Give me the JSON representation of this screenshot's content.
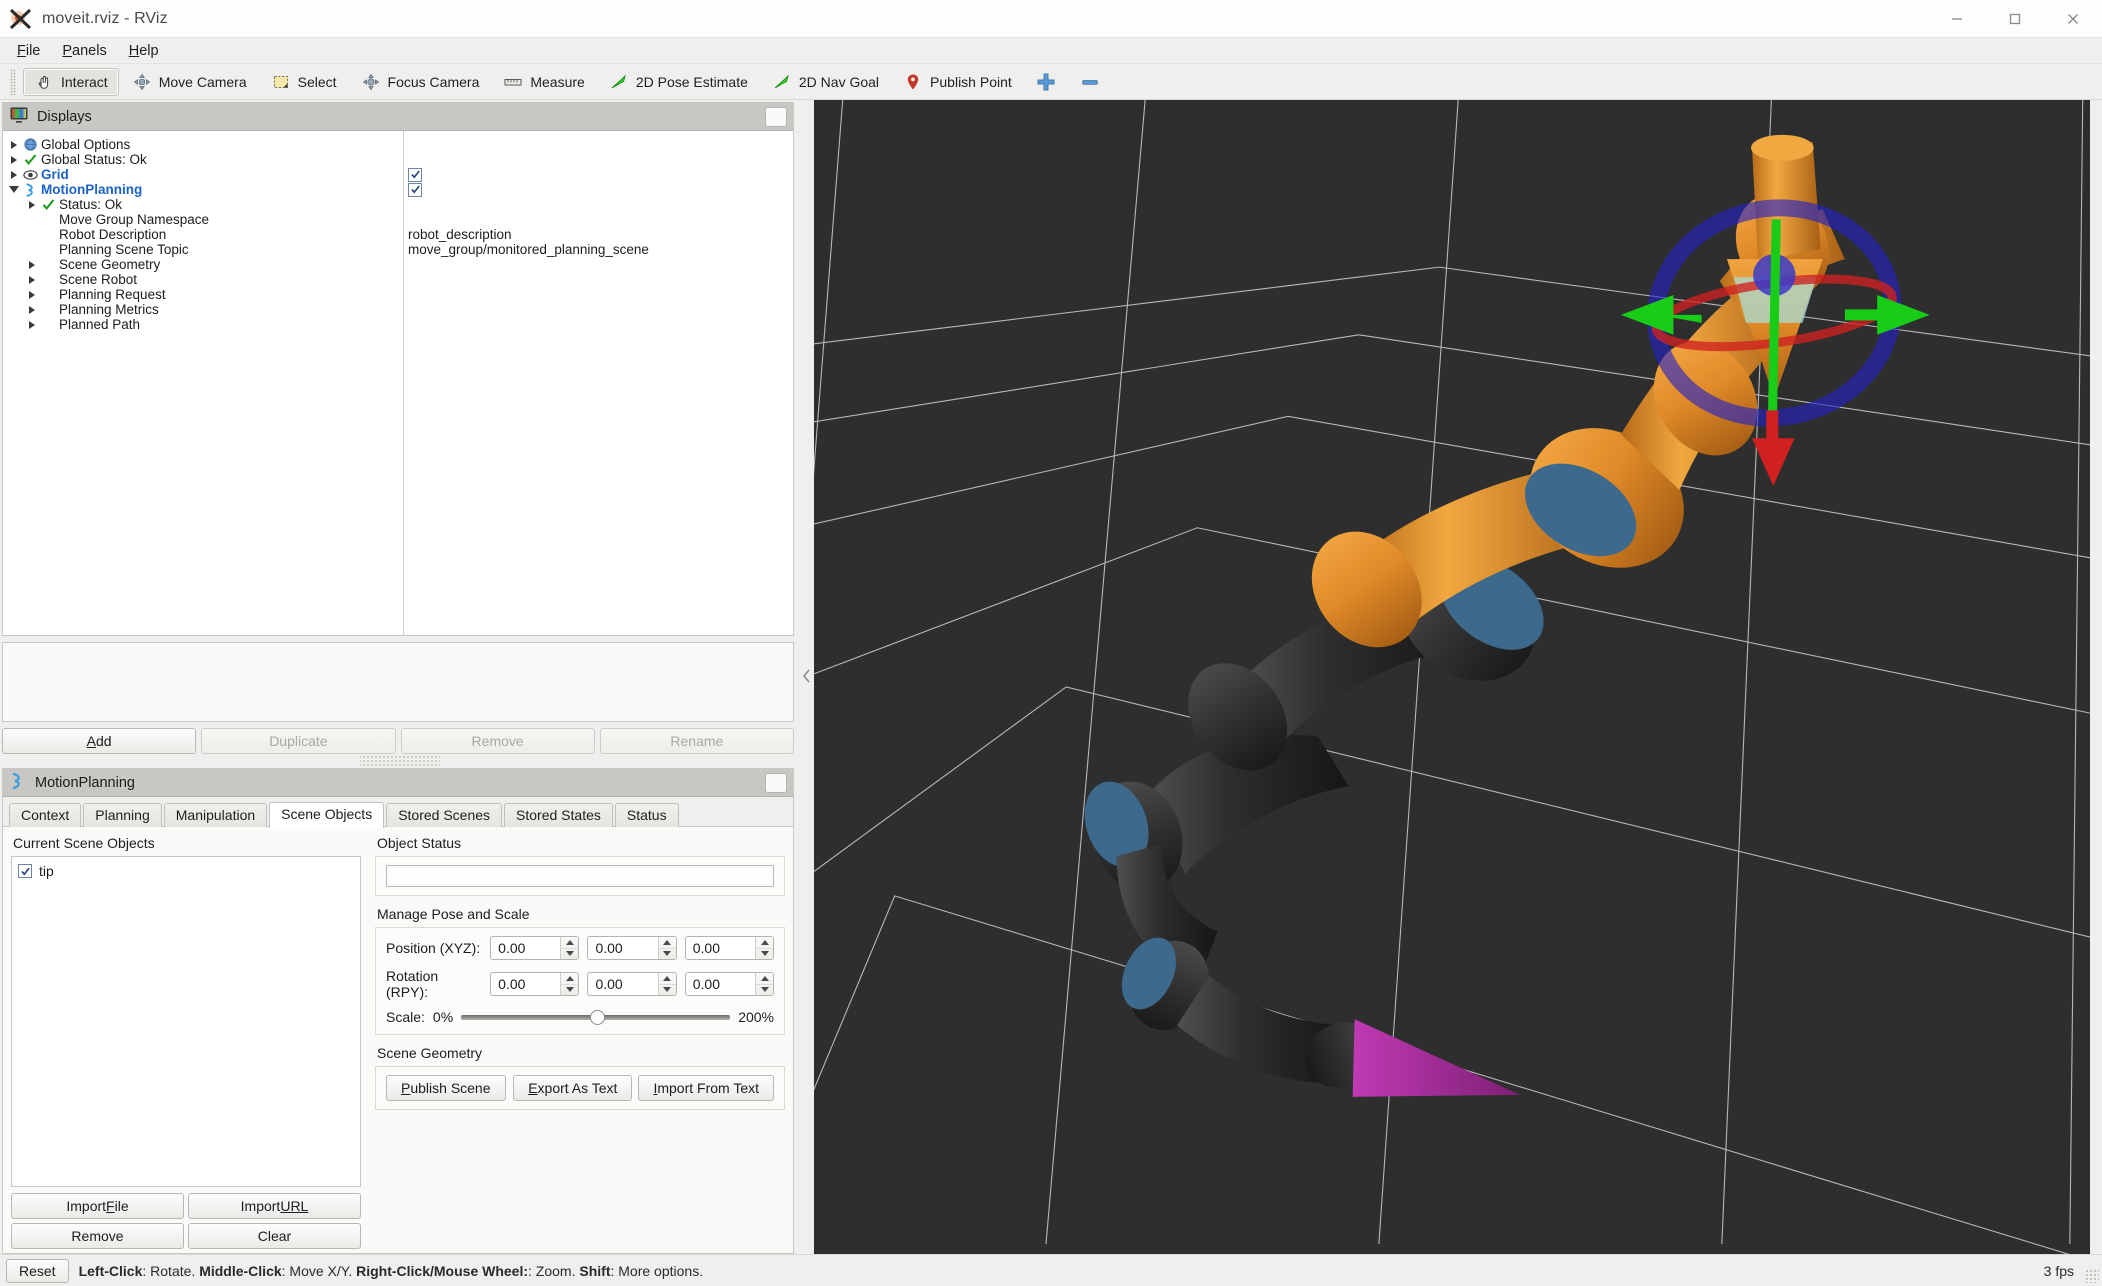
{
  "window": {
    "title": "moveit.rviz - RViz",
    "icon": "rviz-logo-icon",
    "minimize": "minimize-icon",
    "maximize": "maximize-icon",
    "close": "close-icon"
  },
  "menubar": {
    "items": [
      {
        "label": "File",
        "accel": "F"
      },
      {
        "label": "Panels",
        "accel": "P"
      },
      {
        "label": "Help",
        "accel": "H"
      }
    ]
  },
  "toolbar": {
    "items": [
      {
        "label": "Interact",
        "icon": "hand-cursor-icon",
        "active": true
      },
      {
        "label": "Move Camera",
        "icon": "move-camera-icon",
        "active": false
      },
      {
        "label": "Select",
        "icon": "select-rect-icon",
        "active": false
      },
      {
        "label": "Focus Camera",
        "icon": "focus-camera-icon",
        "active": false
      },
      {
        "label": "Measure",
        "icon": "ruler-icon",
        "active": false
      },
      {
        "label": "2D Pose Estimate",
        "icon": "green-arrow-icon",
        "active": false
      },
      {
        "label": "2D Nav Goal",
        "icon": "green-arrow-icon",
        "active": false
      },
      {
        "label": "Publish Point",
        "icon": "map-pin-icon",
        "active": false
      },
      {
        "label": "",
        "icon": "plus-icon",
        "active": false
      },
      {
        "label": "",
        "icon": "minus-icon",
        "active": false
      }
    ]
  },
  "displays": {
    "panel_title": "Displays",
    "panel_icon": "displays-monitor-icon",
    "float_button": "float-panel-button",
    "tree": [
      {
        "indent": 0,
        "expander": "collapsed",
        "icon": "globe-icon",
        "label": "Global Options",
        "style": "plain",
        "value": ""
      },
      {
        "indent": 0,
        "expander": "collapsed",
        "icon": "check-icon",
        "label": "Global Status: Ok",
        "style": "plain",
        "value": ""
      },
      {
        "indent": 0,
        "expander": "collapsed",
        "icon": "grid-eye-icon",
        "label": "Grid",
        "style": "blue",
        "value": "checkbox"
      },
      {
        "indent": 0,
        "expander": "expanded",
        "icon": "motion-icon",
        "label": "MotionPlanning",
        "style": "blue",
        "value": "checkbox"
      },
      {
        "indent": 1,
        "expander": "collapsed",
        "icon": "check-icon",
        "label": "Status: Ok",
        "style": "plain",
        "value": ""
      },
      {
        "indent": 1,
        "expander": "none",
        "icon": "none",
        "label": "Move Group Namespace",
        "style": "plain",
        "value": ""
      },
      {
        "indent": 1,
        "expander": "none",
        "icon": "none",
        "label": "Robot Description",
        "style": "plain",
        "value": "robot_description"
      },
      {
        "indent": 1,
        "expander": "none",
        "icon": "none",
        "label": "Planning Scene Topic",
        "style": "plain",
        "value": "move_group/monitored_planning_scene"
      },
      {
        "indent": 1,
        "expander": "collapsed",
        "icon": "none",
        "label": "Scene Geometry",
        "style": "plain",
        "value": ""
      },
      {
        "indent": 1,
        "expander": "collapsed",
        "icon": "none",
        "label": "Scene Robot",
        "style": "plain",
        "value": ""
      },
      {
        "indent": 1,
        "expander": "collapsed",
        "icon": "none",
        "label": "Planning Request",
        "style": "plain",
        "value": ""
      },
      {
        "indent": 1,
        "expander": "collapsed",
        "icon": "none",
        "label": "Planning Metrics",
        "style": "plain",
        "value": ""
      },
      {
        "indent": 1,
        "expander": "collapsed",
        "icon": "none",
        "label": "Planned Path",
        "style": "plain",
        "value": ""
      }
    ],
    "buttons": [
      {
        "label": "Add",
        "enabled": true
      },
      {
        "label": "Duplicate",
        "enabled": false
      },
      {
        "label": "Remove",
        "enabled": false
      },
      {
        "label": "Rename",
        "enabled": false
      }
    ]
  },
  "motion_planning": {
    "panel_title": "MotionPlanning",
    "panel_icon": "motion-icon",
    "float_button": "float-panel-button",
    "tabs": [
      {
        "label": "Context",
        "selected": false
      },
      {
        "label": "Planning",
        "selected": false
      },
      {
        "label": "Manipulation",
        "selected": false
      },
      {
        "label": "Scene Objects",
        "selected": true
      },
      {
        "label": "Stored Scenes",
        "selected": false
      },
      {
        "label": "Stored States",
        "selected": false
      },
      {
        "label": "Status",
        "selected": false
      }
    ],
    "scene_objects": {
      "list_title": "Current Scene Objects",
      "items": [
        {
          "label": "tip",
          "checked": true
        }
      ],
      "buttons": [
        {
          "label": "Import ",
          "accel": "F",
          "rest": "ile"
        },
        {
          "label": "Import ",
          "accel": "URL",
          "rest": ""
        },
        {
          "label": "Remove",
          "accel": "",
          "rest": ""
        },
        {
          "label": "Clear",
          "accel": "",
          "rest": ""
        }
      ],
      "object_status_title": "Object Status",
      "object_status_value": "",
      "manage_title": "Manage Pose and Scale",
      "position_label": "Position (XYZ):",
      "position_values": [
        "0.00",
        "0.00",
        "0.00"
      ],
      "rotation_label": "Rotation (RPY):",
      "rotation_values": [
        "0.00",
        "0.00",
        "0.00"
      ],
      "scale_label": "Scale:",
      "scale_min": "0%",
      "scale_max": "200%",
      "scale_percent": 48,
      "geometry_title": "Scene Geometry",
      "publish_scene": {
        "pre": "",
        "accel": "P",
        "rest": "ublish Scene"
      },
      "export_text": {
        "pre": "",
        "accel": "E",
        "rest": "xport As Text"
      },
      "import_text": {
        "pre": "",
        "accel": "I",
        "rest": "mport From Text"
      }
    }
  },
  "statusbar": {
    "reset_label": "Reset",
    "hint_parts": [
      {
        "text": "Left-Click",
        "bold": true
      },
      {
        "text": ": Rotate. ",
        "bold": false
      },
      {
        "text": "Middle-Click",
        "bold": true
      },
      {
        "text": ": Move X/Y. ",
        "bold": false
      },
      {
        "text": "Right-Click/Mouse Wheel:",
        "bold": true
      },
      {
        "text": ": Zoom. ",
        "bold": false
      },
      {
        "text": "Shift",
        "bold": true
      },
      {
        "text": ": More options.",
        "bold": false
      }
    ],
    "fps": "3 fps"
  },
  "viewport": {
    "name": "3d-render-view",
    "background_color": "#2e2e2e",
    "grid_color": "#d4d4d4",
    "robot_orange": "#e08a28",
    "robot_dark": "#2b2b2b",
    "robot_blue": "#3d6a8c",
    "marker_green": "#17cc17",
    "marker_red": "#e02020",
    "marker_blue": "#2020c8",
    "ghost_cyan": "#a8ded6",
    "tip_magenta": "#a8279c",
    "collapse_arrow": "collapse-panel-arrow-icon"
  }
}
